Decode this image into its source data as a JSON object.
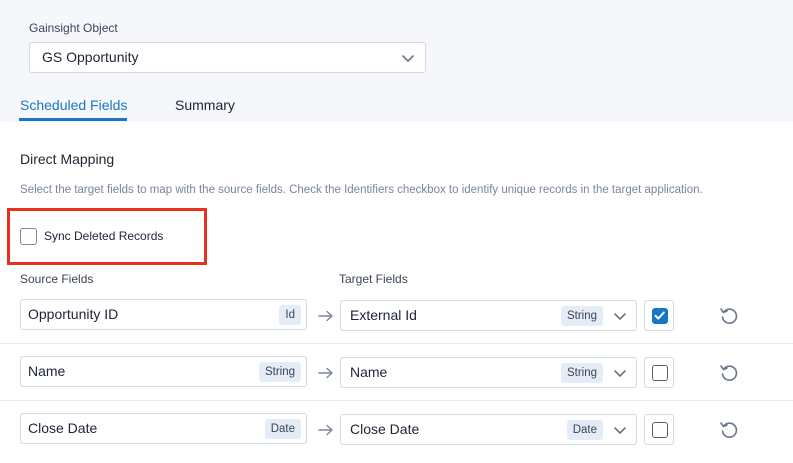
{
  "object": {
    "label": "Gainsight Object",
    "selected": "GS Opportunity"
  },
  "tabs": [
    {
      "label": "Scheduled Fields",
      "active": true
    },
    {
      "label": "Summary",
      "active": false
    }
  ],
  "section": {
    "title": "Direct Mapping",
    "help": "Select the target fields to map with the source fields. Check the Identifiers checkbox to identify unique records in the target application."
  },
  "sync": {
    "label": "Sync Deleted Records",
    "checked": false
  },
  "columns": {
    "source": "Source Fields",
    "target": "Target Fields"
  },
  "mappings": [
    {
      "source": "Opportunity ID",
      "source_type": "Id",
      "target": "External Id",
      "target_type": "String",
      "identifier": true
    },
    {
      "source": "Name",
      "source_type": "String",
      "target": "Name",
      "target_type": "String",
      "identifier": false
    },
    {
      "source": "Close Date",
      "source_type": "Date",
      "target": "Close Date",
      "target_type": "Date",
      "identifier": false
    }
  ],
  "colors": {
    "accent": "#1677c9",
    "highlight": "#e8301e",
    "badge_bg": "#e4ecf7"
  },
  "icons": {
    "dropdown": "chevron-down-icon",
    "map_arrow": "arrow-right-icon",
    "reset": "reset-icon",
    "check": "check-icon"
  }
}
